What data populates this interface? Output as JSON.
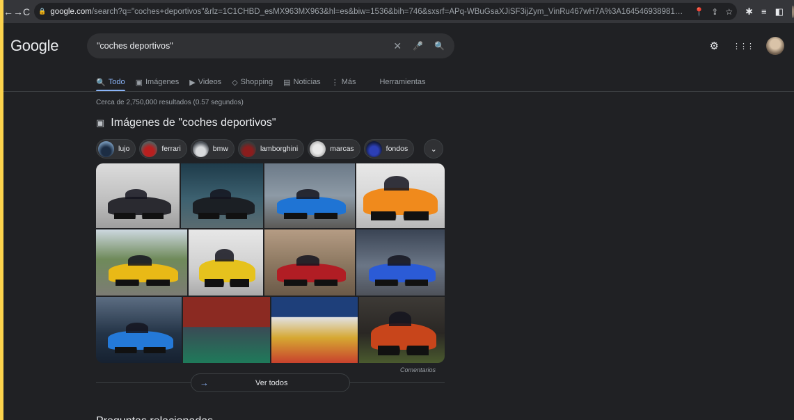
{
  "browser": {
    "back_icon": "←",
    "forward_icon": "→",
    "reload_icon": "C",
    "lock_icon": "🔒",
    "url_host": "google.com",
    "url_rest": "/search?q=\"coches+deportivos\"&rlz=1C1CHBD_esMX963MX963&hl=es&biw=1536&bih=746&sxsrf=APq-WBuGsaXJiSF3ijZym_VinRu467wH7A%3A1645469389816&ei...",
    "location_icon": "📍",
    "share_icon": "⇪",
    "star_icon": "☆",
    "extension_icon": "✱",
    "reading_list_icon": "≡",
    "sidepanel_icon": "◧"
  },
  "google": {
    "logo": "Google",
    "search_query": "\"coches deportivos\"",
    "clear_icon": "✕",
    "mic_icon": "🎤",
    "search_icon": "🔍",
    "settings_icon": "⚙",
    "apps_icon": "⋮⋮⋮"
  },
  "tabs": [
    {
      "label": "Todo",
      "icon": "🔍"
    },
    {
      "label": "Imágenes",
      "icon": "▣"
    },
    {
      "label": "Videos",
      "icon": "▶"
    },
    {
      "label": "Shopping",
      "icon": "◇"
    },
    {
      "label": "Noticias",
      "icon": "▤"
    },
    {
      "label": "Más",
      "icon": "⋮"
    }
  ],
  "tools_label": "Herramientas",
  "result_stats": "Cerca de 2,750,000 resultados (0.57 segundos)",
  "images_section": {
    "icon": "▣",
    "title": "Imágenes de \"coches deportivos\"",
    "chips": [
      {
        "label": "lujo"
      },
      {
        "label": "ferrari"
      },
      {
        "label": "bmw"
      },
      {
        "label": "lamborghini"
      },
      {
        "label": "marcas"
      },
      {
        "label": "fondos"
      }
    ],
    "chips_more_icon": "⌄",
    "commentary": "Comentarios",
    "view_all_icon": "→",
    "view_all_label": "Ver todos"
  },
  "next_heading": "Preguntas relacionadas"
}
